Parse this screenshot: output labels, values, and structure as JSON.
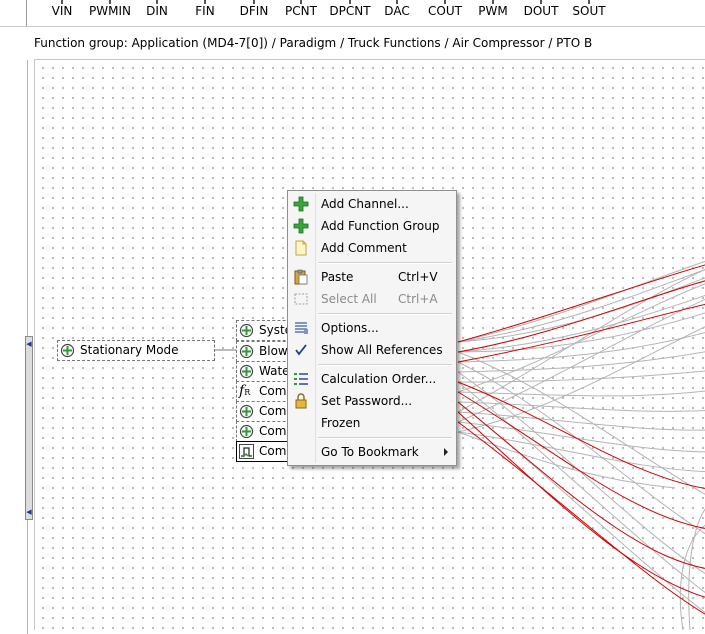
{
  "toolbar": {
    "items": [
      "VIN",
      "PWMIN",
      "DIN",
      "FIN",
      "DFIN",
      "PCNT",
      "DPCNT",
      "DAC",
      "COUT",
      "PWM",
      "DOUT",
      "SOUT"
    ]
  },
  "breadcrumb": {
    "text": "Function group: Application (MD4-7[0]) / Paradigm / Truck Functions / Air Compressor / PTO B"
  },
  "canvas": {
    "blocks": {
      "stationary_mode": "Stationary Mode",
      "row1": "Syste",
      "row2": "Blow",
      "row3": "Wate",
      "row4": "Com",
      "row5": "Com",
      "row6": "Com",
      "row7": "Com",
      "fr_badge": "R"
    },
    "colors": {
      "selected_wire": "#d60000",
      "wire": "#b4b4b4",
      "accent_icon": "#2f9a2f"
    }
  },
  "context_menu": {
    "add_channel": "Add Channel...",
    "add_function_group": "Add Function Group",
    "add_comment": "Add Comment",
    "paste": "Paste",
    "paste_shortcut": "Ctrl+V",
    "select_all": "Select All",
    "select_all_shortcut": "Ctrl+A",
    "options": "Options...",
    "show_all_references": "Show All References",
    "calculation_order": "Calculation Order...",
    "set_password": "Set Password...",
    "frozen": "Frozen",
    "go_to_bookmark": "Go To Bookmark"
  }
}
